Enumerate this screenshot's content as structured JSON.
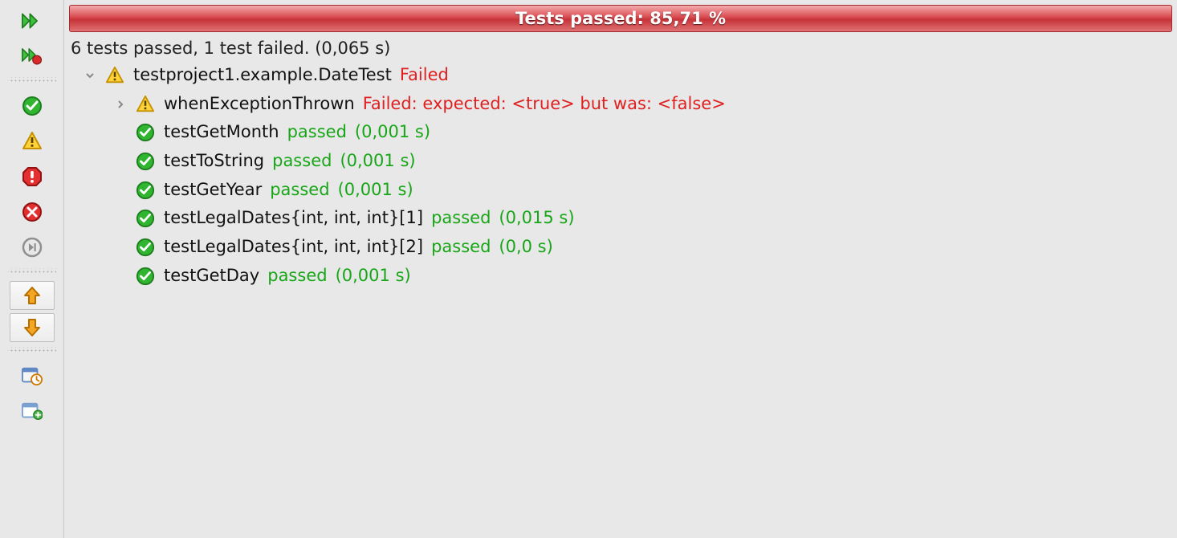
{
  "statusBar": {
    "text": "Tests passed: 85,71 %"
  },
  "summary": "6 tests passed, 1 test failed. (0,065 s)",
  "suite": {
    "name": "testproject1.example.DateTest",
    "status": "Failed"
  },
  "tests": [
    {
      "name": "whenExceptionThrown",
      "status": "Failed: expected: <true> but was: <false>",
      "pass": false,
      "timing": ""
    },
    {
      "name": "testGetMonth",
      "status": "passed",
      "pass": true,
      "timing": "(0,001 s)"
    },
    {
      "name": "testToString",
      "status": "passed",
      "pass": true,
      "timing": "(0,001 s)"
    },
    {
      "name": "testGetYear",
      "status": "passed",
      "pass": true,
      "timing": "(0,001 s)"
    },
    {
      "name": "testLegalDates{int, int, int}[1]",
      "status": "passed",
      "pass": true,
      "timing": "(0,015 s)"
    },
    {
      "name": "testLegalDates{int, int, int}[2]",
      "status": "passed",
      "pass": true,
      "timing": "(0,0 s)"
    },
    {
      "name": "testGetDay",
      "status": "passed",
      "pass": true,
      "timing": "(0,001 s)"
    }
  ]
}
